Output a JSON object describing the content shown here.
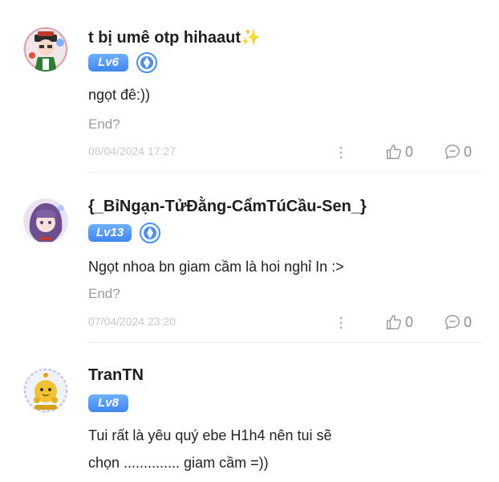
{
  "comments": [
    {
      "username": "t bị umê otp hihaaut✨",
      "level": "Lv6",
      "verified": true,
      "content_lines": [
        "ngọt đê:))"
      ],
      "note": "End?",
      "timestamp": "08/04/2024 17:27",
      "likes": "0",
      "replies": "0"
    },
    {
      "username": "{_BỉNgạn-TửĐằng-CẩmTúCầu-Sen_}",
      "level": "Lv13",
      "verified": true,
      "content_lines": [
        "Ngọt nhoa bn giam cầm là hoi nghỉ In :>"
      ],
      "note": "End?",
      "timestamp": "07/04/2024 23:20",
      "likes": "0",
      "replies": "0"
    },
    {
      "username": "TranTN",
      "level": "Lv8",
      "verified": false,
      "content_lines": [
        "Tui rất là yêu quý ebe H1h4 nên tui sẽ",
        "chọn .............. giam cầm =))"
      ]
    }
  ],
  "icons": {
    "verify": "verified-shield-icon",
    "like": "thumbs-up-icon",
    "reply": "comment-bubble-icon",
    "more": "more-vertical-icon"
  },
  "colors": {
    "level_badge": "#4a90f0",
    "muted_text": "#9a9a9a",
    "timestamp": "#c8c8c8",
    "icon_gray": "#9b9b9b"
  }
}
